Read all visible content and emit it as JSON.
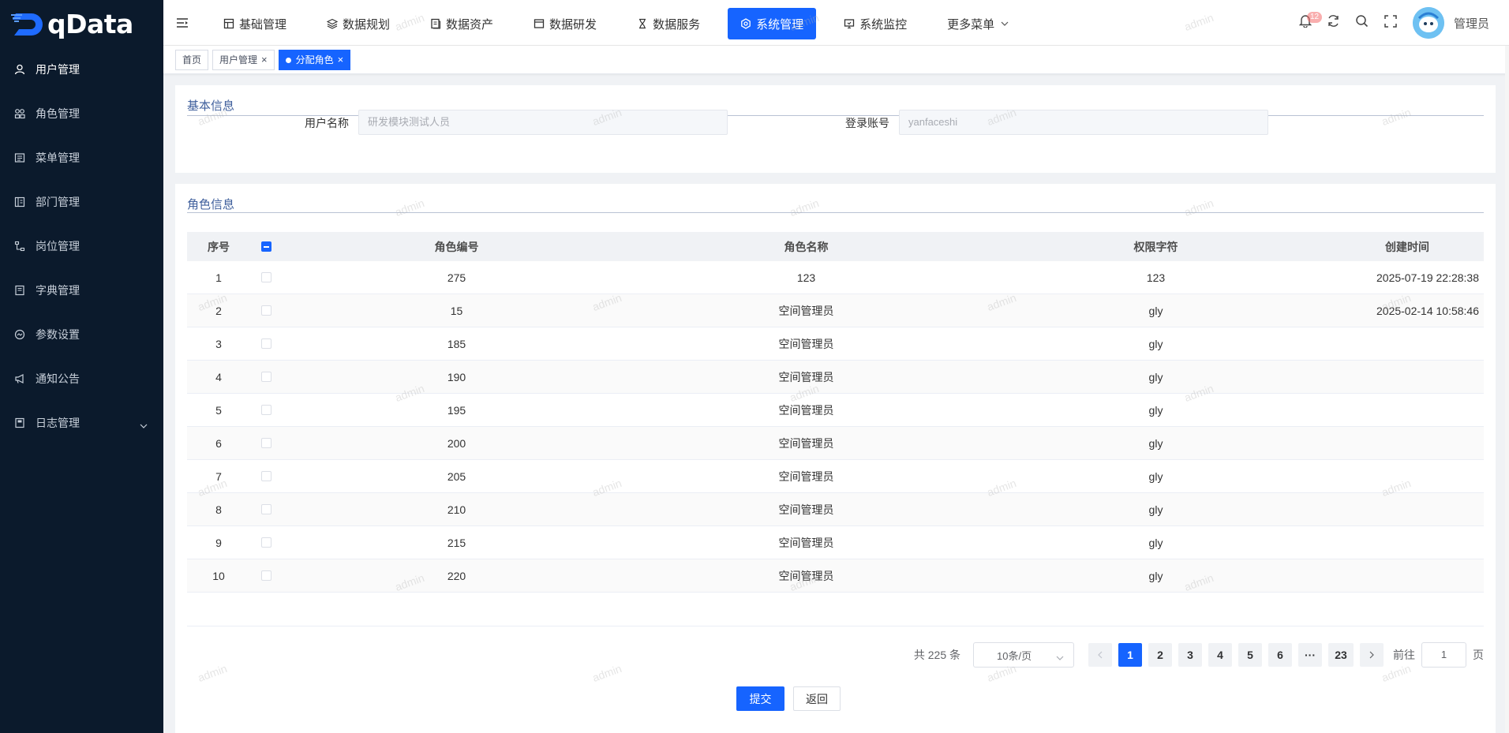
{
  "app": {
    "logo_text": "qData"
  },
  "sidebar": {
    "items": [
      {
        "label": "用户管理",
        "icon": "user-icon"
      },
      {
        "label": "角色管理",
        "icon": "role-icon"
      },
      {
        "label": "菜单管理",
        "icon": "menu-icon"
      },
      {
        "label": "部门管理",
        "icon": "department-icon"
      },
      {
        "label": "岗位管理",
        "icon": "post-icon"
      },
      {
        "label": "字典管理",
        "icon": "dictionary-icon"
      },
      {
        "label": "参数设置",
        "icon": "settings-icon"
      },
      {
        "label": "通知公告",
        "icon": "megaphone-icon"
      },
      {
        "label": "日志管理",
        "icon": "log-icon"
      }
    ]
  },
  "topnav": {
    "items": [
      {
        "label": "基础管理"
      },
      {
        "label": "数据规划"
      },
      {
        "label": "数据资产"
      },
      {
        "label": "数据研发"
      },
      {
        "label": "数据服务"
      },
      {
        "label": "系统管理"
      },
      {
        "label": "系统监控"
      },
      {
        "label": "更多菜单"
      }
    ],
    "badge": "12",
    "user_name": "管理员"
  },
  "tabs": [
    {
      "label": "首页"
    },
    {
      "label": "用户管理"
    },
    {
      "label": "分配角色"
    }
  ],
  "basic_info": {
    "title": "基本信息",
    "username_label": "用户名称",
    "username_value": "研发模块测试人员",
    "account_label": "登录账号",
    "account_value": "yanfaceshi"
  },
  "role_info": {
    "title": "角色信息",
    "columns": [
      "序号",
      "角色编号",
      "角色名称",
      "权限字符",
      "创建时间"
    ],
    "rows": [
      {
        "idx": "1",
        "id": "275",
        "name": "123",
        "key": "123",
        "time": "2025-07-19 22:28:38"
      },
      {
        "idx": "2",
        "id": "15",
        "name": "空间管理员",
        "key": "gly",
        "time": "2025-02-14 10:58:46"
      },
      {
        "idx": "3",
        "id": "185",
        "name": "空间管理员",
        "key": "gly",
        "time": ""
      },
      {
        "idx": "4",
        "id": "190",
        "name": "空间管理员",
        "key": "gly",
        "time": ""
      },
      {
        "idx": "5",
        "id": "195",
        "name": "空间管理员",
        "key": "gly",
        "time": ""
      },
      {
        "idx": "6",
        "id": "200",
        "name": "空间管理员",
        "key": "gly",
        "time": ""
      },
      {
        "idx": "7",
        "id": "205",
        "name": "空间管理员",
        "key": "gly",
        "time": ""
      },
      {
        "idx": "8",
        "id": "210",
        "name": "空间管理员",
        "key": "gly",
        "time": ""
      },
      {
        "idx": "9",
        "id": "215",
        "name": "空间管理员",
        "key": "gly",
        "time": ""
      },
      {
        "idx": "10",
        "id": "220",
        "name": "空间管理员",
        "key": "gly",
        "time": ""
      }
    ]
  },
  "pagination": {
    "total": "共 225 条",
    "page_size": "10条/页",
    "pages": [
      "1",
      "2",
      "3",
      "4",
      "5",
      "6"
    ],
    "ellipsis": "···",
    "last_page": "23",
    "goto_label": "前往",
    "goto_value": "1",
    "page_unit": "页"
  },
  "actions": {
    "submit": "提交",
    "back": "返回"
  },
  "watermark": "admin",
  "colors": {
    "primary": "#1664ff",
    "sidebar_bg": "#0b1a2c"
  }
}
